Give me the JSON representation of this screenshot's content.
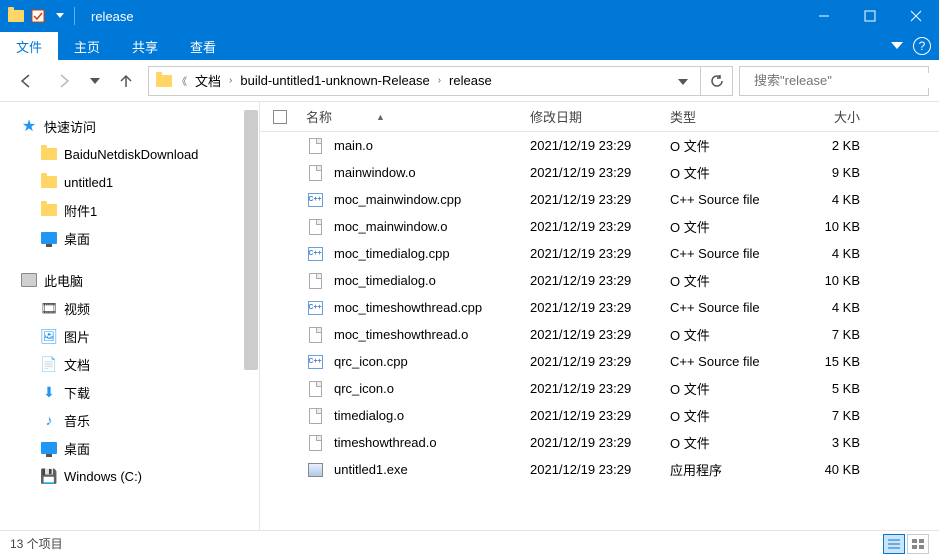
{
  "window": {
    "title": "release"
  },
  "ribbon": {
    "tabs": [
      "文件",
      "主页",
      "共享",
      "查看"
    ],
    "active_index": 0
  },
  "breadcrumb": {
    "items": [
      "文档",
      "build-untitled1-unknown-Release",
      "release"
    ]
  },
  "search": {
    "placeholder": "搜索\"release\""
  },
  "sidebar": {
    "quick_access": "快速访问",
    "quick_items": [
      {
        "label": "BaiduNetdiskDownload",
        "icon": "folder"
      },
      {
        "label": "untitled1",
        "icon": "folder"
      },
      {
        "label": "附件1",
        "icon": "folder"
      },
      {
        "label": "桌面",
        "icon": "desktop"
      }
    ],
    "this_pc": "此电脑",
    "pc_items": [
      {
        "label": "视频",
        "icon": "video",
        "color": "#444"
      },
      {
        "label": "图片",
        "icon": "pictures",
        "color": "#2196f3"
      },
      {
        "label": "文档",
        "icon": "documents",
        "color": "#555"
      },
      {
        "label": "下载",
        "icon": "downloads",
        "color": "#2196f3"
      },
      {
        "label": "音乐",
        "icon": "music",
        "color": "#2196f3"
      },
      {
        "label": "桌面",
        "icon": "desktop",
        "color": "#2196f3"
      },
      {
        "label": "Windows (C:)",
        "icon": "drive",
        "color": "#888"
      }
    ]
  },
  "columns": {
    "name": "名称",
    "date": "修改日期",
    "type": "类型",
    "size": "大小"
  },
  "files": [
    {
      "name": "main.o",
      "date": "2021/12/19 23:29",
      "type": "O 文件",
      "size": "2 KB",
      "icon": "doc"
    },
    {
      "name": "mainwindow.o",
      "date": "2021/12/19 23:29",
      "type": "O 文件",
      "size": "9 KB",
      "icon": "doc"
    },
    {
      "name": "moc_mainwindow.cpp",
      "date": "2021/12/19 23:29",
      "type": "C++ Source file",
      "size": "4 KB",
      "icon": "cpp"
    },
    {
      "name": "moc_mainwindow.o",
      "date": "2021/12/19 23:29",
      "type": "O 文件",
      "size": "10 KB",
      "icon": "doc"
    },
    {
      "name": "moc_timedialog.cpp",
      "date": "2021/12/19 23:29",
      "type": "C++ Source file",
      "size": "4 KB",
      "icon": "cpp"
    },
    {
      "name": "moc_timedialog.o",
      "date": "2021/12/19 23:29",
      "type": "O 文件",
      "size": "10 KB",
      "icon": "doc"
    },
    {
      "name": "moc_timeshowthread.cpp",
      "date": "2021/12/19 23:29",
      "type": "C++ Source file",
      "size": "4 KB",
      "icon": "cpp"
    },
    {
      "name": "moc_timeshowthread.o",
      "date": "2021/12/19 23:29",
      "type": "O 文件",
      "size": "7 KB",
      "icon": "doc"
    },
    {
      "name": "qrc_icon.cpp",
      "date": "2021/12/19 23:29",
      "type": "C++ Source file",
      "size": "15 KB",
      "icon": "cpp"
    },
    {
      "name": "qrc_icon.o",
      "date": "2021/12/19 23:29",
      "type": "O 文件",
      "size": "5 KB",
      "icon": "doc"
    },
    {
      "name": "timedialog.o",
      "date": "2021/12/19 23:29",
      "type": "O 文件",
      "size": "7 KB",
      "icon": "doc"
    },
    {
      "name": "timeshowthread.o",
      "date": "2021/12/19 23:29",
      "type": "O 文件",
      "size": "3 KB",
      "icon": "doc"
    },
    {
      "name": "untitled1.exe",
      "date": "2021/12/19 23:29",
      "type": "应用程序",
      "size": "40 KB",
      "icon": "exe"
    }
  ],
  "status": {
    "item_count": "13 个项目"
  }
}
